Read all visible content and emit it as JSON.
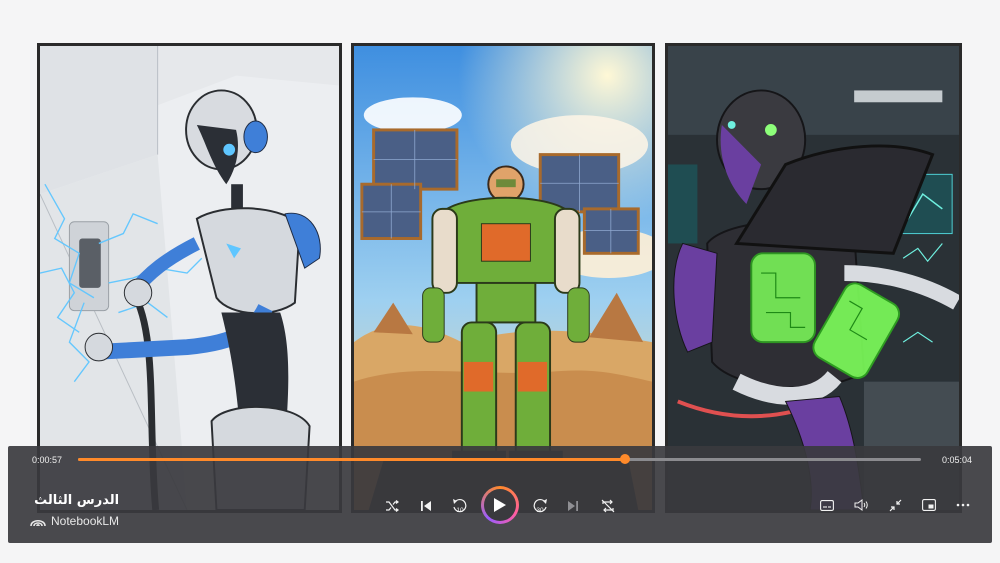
{
  "player": {
    "current_time": "0:00:57",
    "total_time": "0:05:04",
    "progress_fraction": 0.649,
    "lesson_title": "الدرس الثالث",
    "brand": "NotebookLM",
    "accent_color": "#ff8a2a",
    "controls_left": [
      {
        "name": "shuffle-button",
        "icon": "shuffle-icon"
      },
      {
        "name": "previous-button",
        "icon": "skip-previous-icon"
      },
      {
        "name": "rewind-10-button",
        "icon": "replay-10-icon",
        "label": "10"
      },
      {
        "name": "play-button",
        "icon": "play-icon"
      },
      {
        "name": "forward-30-button",
        "icon": "forward-30-icon",
        "label": "30"
      },
      {
        "name": "next-button",
        "icon": "skip-next-icon"
      },
      {
        "name": "repeat-off-button",
        "icon": "repeat-off-icon"
      }
    ],
    "controls_right": [
      {
        "name": "captions-button",
        "icon": "captions-icon"
      },
      {
        "name": "volume-button",
        "icon": "volume-icon"
      },
      {
        "name": "minimize-button",
        "icon": "collapse-icon"
      },
      {
        "name": "pip-button",
        "icon": "picture-in-picture-icon"
      },
      {
        "name": "more-button",
        "icon": "more-horizontal-icon"
      }
    ]
  },
  "video": {
    "panels": [
      {
        "name": "panel-robot-charging",
        "palette": "white-blue"
      },
      {
        "name": "panel-robot-solar",
        "palette": "desert-green"
      },
      {
        "name": "panel-robot-battery",
        "palette": "dark-purple"
      }
    ]
  }
}
